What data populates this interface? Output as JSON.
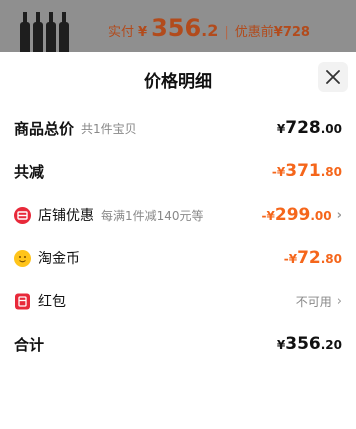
{
  "top": {
    "paid_label": "实付",
    "paid_currency": "¥",
    "paid_int": "356",
    "paid_dec": ".2",
    "separator": "|",
    "pre_discount_label": "优惠前",
    "pre_discount_value": "¥728"
  },
  "sheet": {
    "title": "价格明细",
    "close_icon": "close-icon"
  },
  "rows": {
    "total_goods": {
      "label": "商品总价",
      "sub": "共1件宝贝",
      "currency": "¥",
      "int": "728",
      "dec": ".00"
    },
    "total_reduce": {
      "label": "共减",
      "prefix": "-¥",
      "int": "371",
      "dec": ".80"
    },
    "store_discount": {
      "label": "店铺优惠",
      "sub": "每满1件减140元等",
      "prefix": "-¥",
      "int": "299",
      "dec": ".00",
      "icon": "store-coupon-icon"
    },
    "taojinbi": {
      "label": "淘金币",
      "prefix": "-¥",
      "int": "72",
      "dec": ".80",
      "icon": "gold-coin-icon"
    },
    "hongbao": {
      "label": "红包",
      "status": "不可用",
      "icon": "red-packet-icon"
    },
    "sum": {
      "label": "合计",
      "currency": "¥",
      "int": "356",
      "dec": ".20"
    }
  },
  "colors": {
    "accent": "#f5661b",
    "text": "#111111",
    "muted": "#888888"
  }
}
